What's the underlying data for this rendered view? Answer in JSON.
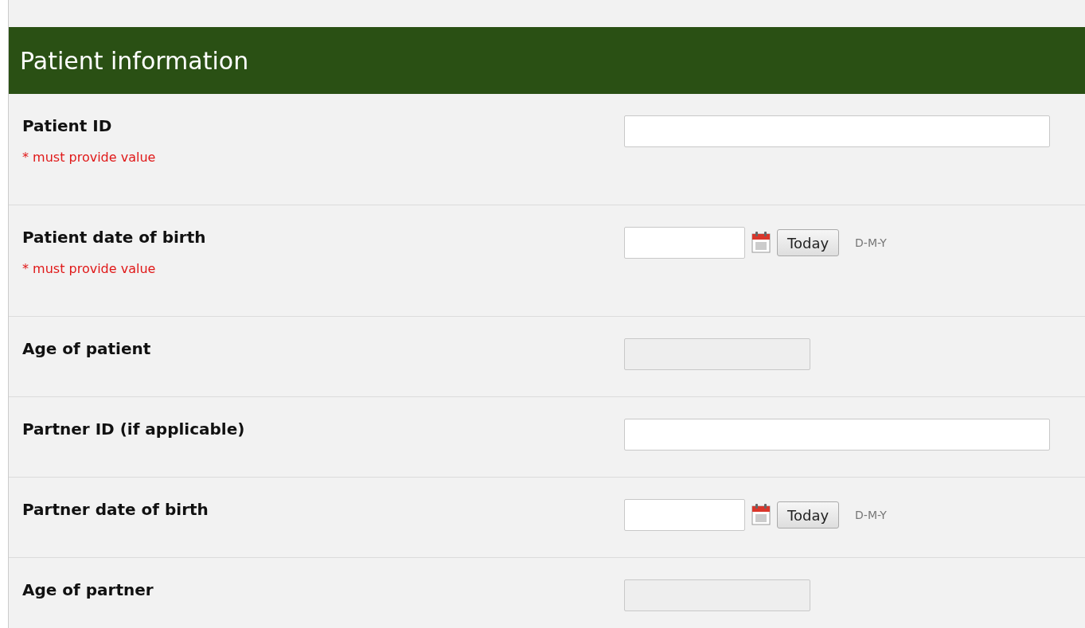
{
  "section": {
    "title": "Patient information"
  },
  "fields": [
    {
      "kind": "text",
      "label": "Patient ID",
      "required_note": "* must provide value"
    },
    {
      "kind": "date",
      "label": "Patient date of birth",
      "required_note": "* must provide value",
      "today_button": "Today",
      "format_hint": "D-M-Y"
    },
    {
      "kind": "readonly",
      "label": "Age of patient"
    },
    {
      "kind": "text",
      "label": "Partner ID (if applicable)"
    },
    {
      "kind": "date",
      "label": "Partner date of birth",
      "today_button": "Today",
      "format_hint": "D-M-Y"
    },
    {
      "kind": "readonly",
      "label": "Age of partner"
    }
  ]
}
